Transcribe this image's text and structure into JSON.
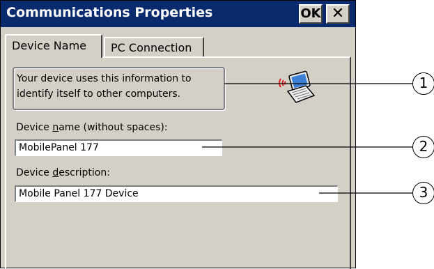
{
  "window": {
    "title": "Communications Properties",
    "ok_label": "OK",
    "close_glyph": "✕"
  },
  "tabs": [
    {
      "label": "Device Name",
      "selected": true
    },
    {
      "label": "PC Connection",
      "selected": false
    }
  ],
  "info_text_line1": "Your device uses this information to",
  "info_text_line2": "identify itself to other computers.",
  "device_name": {
    "label_pre": "Device ",
    "label_hotkey": "n",
    "label_post": "ame (without spaces):",
    "value": "MobilePanel 177"
  },
  "device_description": {
    "label_pre": "Device ",
    "label_hotkey": "d",
    "label_post": "escription:",
    "value": "Mobile Panel 177 Device"
  },
  "callouts": [
    "1",
    "2",
    "3"
  ],
  "icons": {
    "device": "laptop-wireless-icon"
  }
}
